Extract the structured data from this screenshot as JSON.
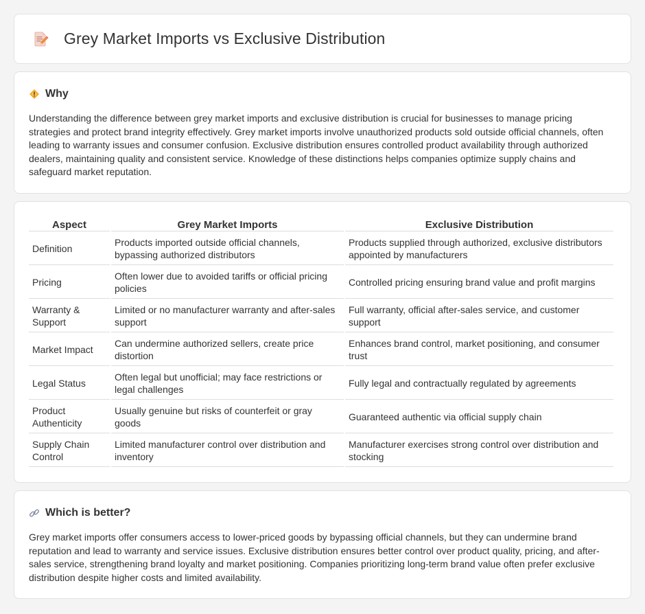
{
  "page": {
    "title": "Grey Market Imports vs Exclusive Distribution",
    "title_icon": "document-pencil-icon"
  },
  "why": {
    "heading": "Why",
    "icon": "diamond-warning-icon",
    "text": "Understanding the difference between grey market imports and exclusive distribution is crucial for businesses to manage pricing strategies and protect brand integrity effectively. Grey market imports involve unauthorized products sold outside official channels, often leading to warranty issues and consumer confusion. Exclusive distribution ensures controlled product availability through authorized dealers, maintaining quality and consistent service. Knowledge of these distinctions helps companies optimize supply chains and safeguard market reputation."
  },
  "table": {
    "headers": [
      "Aspect",
      "Grey Market Imports",
      "Exclusive Distribution"
    ],
    "rows": [
      [
        "Definition",
        "Products imported outside official channels, bypassing authorized distributors",
        "Products supplied through authorized, exclusive distributors appointed by manufacturers"
      ],
      [
        "Pricing",
        "Often lower due to avoided tariffs or official pricing policies",
        "Controlled pricing ensuring brand value and profit margins"
      ],
      [
        "Warranty & Support",
        "Limited or no manufacturer warranty and after-sales support",
        "Full warranty, official after-sales service, and customer support"
      ],
      [
        "Market Impact",
        "Can undermine authorized sellers, create price distortion",
        "Enhances brand control, market positioning, and consumer trust"
      ],
      [
        "Legal Status",
        "Often legal but unofficial; may face restrictions or legal challenges",
        "Fully legal and contractually regulated by agreements"
      ],
      [
        "Product Authenticity",
        "Usually genuine but risks of counterfeit or gray goods",
        "Guaranteed authentic via official supply chain"
      ],
      [
        "Supply Chain Control",
        "Limited manufacturer control over distribution and inventory",
        "Manufacturer exercises strong control over distribution and stocking"
      ]
    ]
  },
  "which": {
    "heading": "Which is better?",
    "icon": "link-icon",
    "text": "Grey market imports offer consumers access to lower-priced goods by bypassing official channels, but they can undermine brand reputation and lead to warranty and service issues. Exclusive distribution ensures better control over product quality, pricing, and after-sales service, strengthening brand loyalty and market positioning. Companies prioritizing long-term brand value often prefer exclusive distribution despite higher costs and limited availability."
  }
}
